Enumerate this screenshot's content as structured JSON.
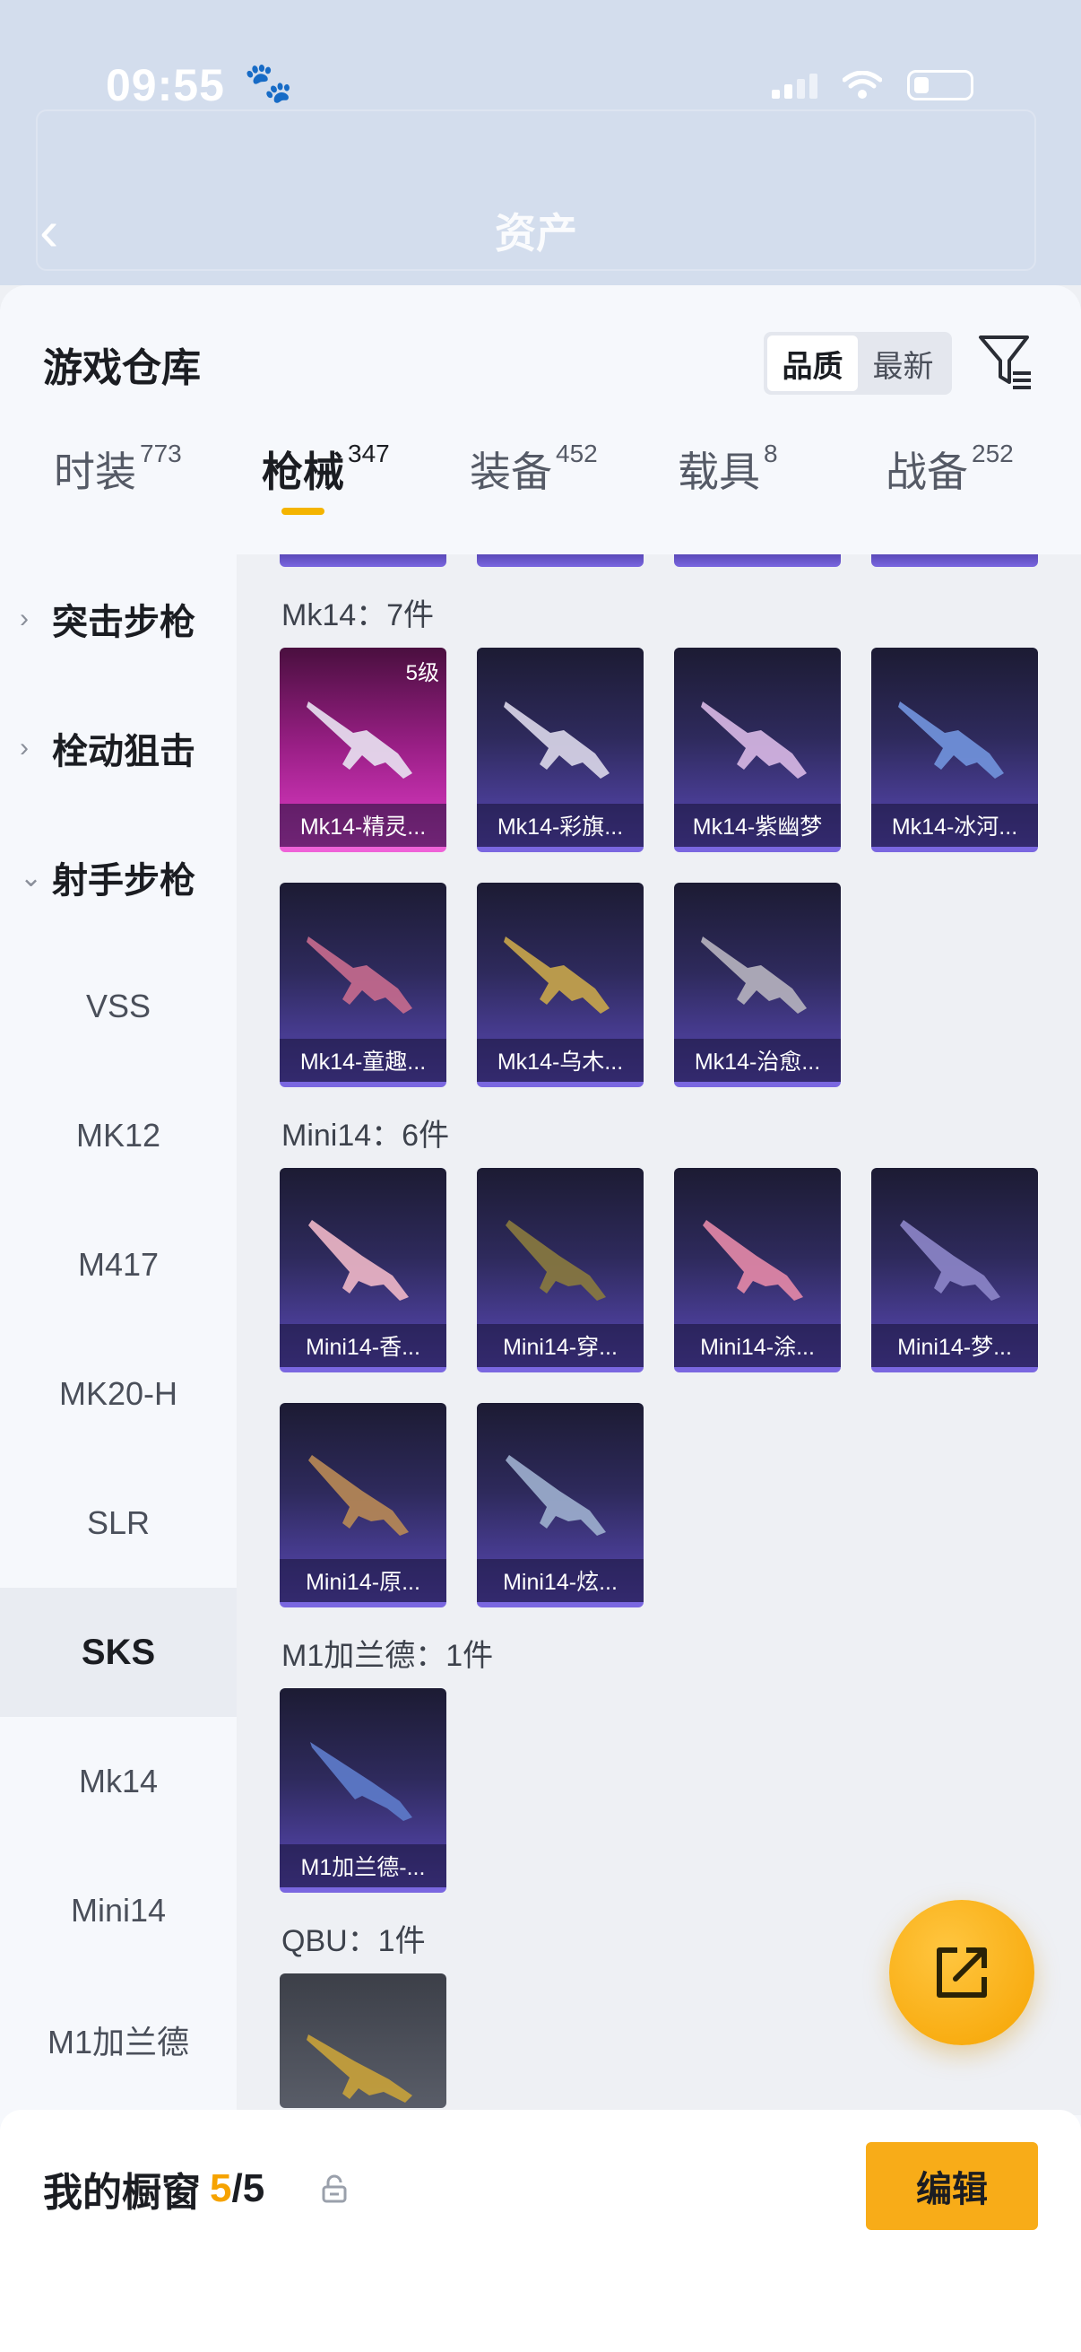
{
  "status_bar": {
    "time": "09:55"
  },
  "background": {
    "title": "资产"
  },
  "header": {
    "title": "游戏仓库",
    "sort_options": [
      "品质",
      "最新"
    ],
    "active_sort": "品质"
  },
  "tabs": [
    {
      "label": "时装",
      "count": "773"
    },
    {
      "label": "枪械",
      "count": "347"
    },
    {
      "label": "装备",
      "count": "452"
    },
    {
      "label": "载具",
      "count": "8"
    },
    {
      "label": "战备",
      "count": "252"
    }
  ],
  "active_tab": "枪械",
  "sidebar": {
    "categories": [
      {
        "label": "突击步枪",
        "expanded": false
      },
      {
        "label": "栓动狙击",
        "expanded": false
      },
      {
        "label": "射手步枪",
        "expanded": true
      }
    ],
    "items": [
      "VSS",
      "MK12",
      "M417",
      "MK20-H",
      "SLR",
      "SKS",
      "Mk14",
      "Mini14",
      "M1加兰德"
    ],
    "selected": "SKS"
  },
  "groups": [
    {
      "title": "Mk14：7件",
      "items": [
        {
          "name": "Mk14-精灵...",
          "level": "5级",
          "rarity": "legendary"
        },
        {
          "name": "Mk14-彩旗...",
          "rarity": "epic"
        },
        {
          "name": "Mk14-紫幽梦",
          "rarity": "epic"
        },
        {
          "name": "Mk14-冰河...",
          "rarity": "epic"
        },
        {
          "name": "Mk14-童趣...",
          "rarity": "epic"
        },
        {
          "name": "Mk14-乌木...",
          "rarity": "epic"
        },
        {
          "name": "Mk14-治愈...",
          "rarity": "epic"
        }
      ]
    },
    {
      "title": "Mini14：6件",
      "items": [
        {
          "name": "Mini14-香...",
          "rarity": "epic"
        },
        {
          "name": "Mini14-穿...",
          "rarity": "epic"
        },
        {
          "name": "Mini14-涂...",
          "rarity": "epic"
        },
        {
          "name": "Mini14-梦...",
          "rarity": "epic"
        },
        {
          "name": "Mini14-原...",
          "rarity": "epic"
        },
        {
          "name": "Mini14-炫...",
          "rarity": "epic"
        }
      ]
    },
    {
      "title": "M1加兰德：1件",
      "items": [
        {
          "name": "M1加兰德-...",
          "rarity": "epic"
        }
      ]
    },
    {
      "title": "QBU：1件",
      "items": [
        {
          "name": "",
          "rarity": "common"
        }
      ]
    }
  ],
  "bottom_bar": {
    "title": "我的橱窗",
    "current": "5",
    "total": "/5",
    "edit_label": "编辑"
  },
  "colors": {
    "accent": "#f8ac18",
    "legendary": "#e03cc8",
    "epic": "#5a49b8",
    "tab_underline": "#f4b400"
  }
}
